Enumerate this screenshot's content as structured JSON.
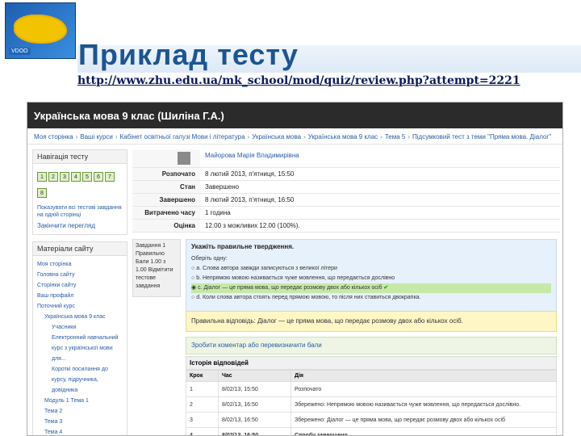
{
  "slide": {
    "title": "Приклад тесту",
    "url": "http://www.zhu.edu.ua/mk_school/mod/quiz/review.php?attempt=2221",
    "logo_text": "VDOO"
  },
  "page": {
    "header": "Українська мова 9 клас (Шиліна Г.А.)",
    "breadcrumbs": [
      "Моя сторінка",
      "Ваші курси",
      "Кабінет освітньої галузі Мови і література",
      "Українська мова",
      "Українська мова 9 клас",
      "Тема 5",
      "Підсумковий тест з теми \"Пряма мова. Діалог\""
    ]
  },
  "nav": {
    "title": "Навігація тесту",
    "buttons": [
      "1",
      "2",
      "3",
      "4",
      "5",
      "6",
      "7",
      "8"
    ],
    "show_all": "Показувати всі тестові завдання на одній сторінці",
    "finish": "Закінчити перегляд"
  },
  "site": {
    "title": "Матеріали сайту",
    "items": [
      {
        "label": "Моя сторінка",
        "level": 1
      },
      {
        "label": "Головна сайту",
        "level": 1
      },
      {
        "label": "Сторінки сайту",
        "level": 1
      },
      {
        "label": "Ваш профайл",
        "level": 1
      },
      {
        "label": "Поточний курс",
        "level": 1
      },
      {
        "label": "Українська мова 9 клас",
        "level": 2
      },
      {
        "label": "Учасники",
        "level": 3
      },
      {
        "label": "Електронний навчальний курс з української мови для...",
        "level": 3
      },
      {
        "label": "Короткі посилання до курсу, підручника, довідника",
        "level": 3
      },
      {
        "label": "Модуль 1 Тема 1",
        "level": 2
      },
      {
        "label": "Тема 2",
        "level": 2
      },
      {
        "label": "Тема 3",
        "level": 2
      },
      {
        "label": "Тема 4",
        "level": 2
      }
    ]
  },
  "summary": {
    "user": "Майорова Марія Владимирівна",
    "rows": [
      {
        "label": "Розпочато",
        "value": "8 лютий 2013, п'ятниця, 15:50"
      },
      {
        "label": "Стан",
        "value": "Завершено"
      },
      {
        "label": "Завершено",
        "value": "8 лютий 2013, п'ятниця, 16:50"
      },
      {
        "label": "Витрачено часу",
        "value": "1 година"
      },
      {
        "label": "Оцінка",
        "value": "12.00 з можливих 12.00 (100%)."
      }
    ]
  },
  "question": {
    "info": "Завдання 1  Правильно  Бали 1.00 з 1.00  Відмітити тестове завдання",
    "prompt": "Укажіть правильне твердження.",
    "choose": "Оберіть одну:",
    "options": [
      "a. Слова автора завжди записуються з великої літери",
      "b. Непрямою мовою називається чуже мовлення, що передається дослівно",
      "c. Діалог — це пряма мова, що передає розмову двох або кількох осіб",
      "d. Коли слова автора стоять перед прямою мовою, то після них ставиться двокрапка."
    ],
    "correct_index": 2
  },
  "feedback": {
    "text": "Правильна відповідь: Діалог — це пряма мова, що передає розмову двох або кількох осіб."
  },
  "comment": {
    "label": "Зробити коментар або перевизначити бали"
  },
  "history": {
    "title": "Історія відповідей",
    "columns": [
      "Крок",
      "Час",
      "Дія"
    ],
    "rows": [
      {
        "step": "1",
        "time": "8/02/13, 15:50",
        "action": "Розпочато"
      },
      {
        "step": "2",
        "time": "8/02/13, 16:50",
        "action": "Збережено: Непрямою мовою називається чуже мовлення, що передається дослівно."
      },
      {
        "step": "3",
        "time": "8/02/13, 16:50",
        "action": "Збережено: Діалог — це пряма мова, що передає розмову двох або кількох осіб"
      },
      {
        "step": "4",
        "time": "8/02/13, 16:50",
        "action": "Спробу завершено"
      }
    ]
  }
}
